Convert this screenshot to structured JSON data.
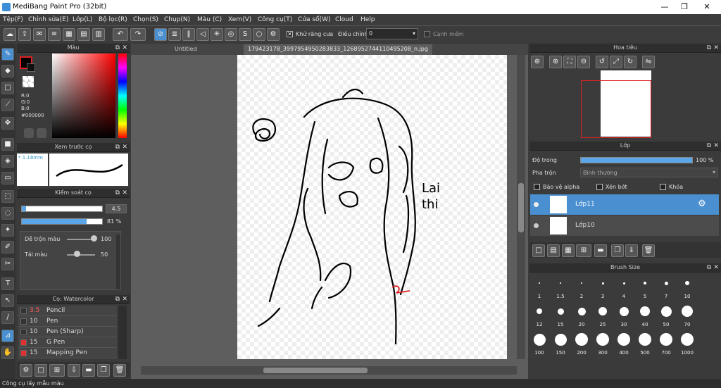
{
  "window": {
    "title": "MediBang Paint Pro (32bit)"
  },
  "menu": [
    "Tệp(F)",
    "Chỉnh sửa(E)",
    "Lớp(L)",
    "Bộ lọc(R)",
    "Chọn(S)",
    "Chụp(N)",
    "Màu (C)",
    "Xem(V)",
    "Công cụ(T)",
    "Cửa sổ(W)",
    "Cloud",
    "Help"
  ],
  "toolbar": {
    "antialias_label": "Khử răng cưa",
    "correction_label": "Điều chỉnh",
    "correction_value": "0",
    "sharp_label": "Cạnh mềm"
  },
  "color_panel": {
    "title": "Màu",
    "r": "R:0",
    "g": "G:0",
    "b": "B:0",
    "hex": "#000000",
    "accent": "#4a90d0"
  },
  "brush_preview": {
    "title": "Xem trước cọ",
    "size": "* 1.18mm"
  },
  "brush_control": {
    "title": "Kiểm soát cọ",
    "size_value": "4.5",
    "opacity_value": "81 %",
    "opacity_fraction": 0.81,
    "size_fraction": 0.05,
    "mix_label": "Dễ trộn màu",
    "mix_value": "100",
    "refill_label": "Tải màu",
    "refill_value": "50"
  },
  "brush_list": {
    "title": "Cọ: Watercolor",
    "items": [
      {
        "size": "3.5",
        "name": "Pencil",
        "color": "#333333",
        "red": true
      },
      {
        "size": "10",
        "name": "Pen",
        "color": "#333333",
        "red": false
      },
      {
        "size": "10",
        "name": "Pen (Sharp)",
        "color": "#333333",
        "red": false
      },
      {
        "size": "15",
        "name": "G Pen",
        "color": "#e03030",
        "red": false
      },
      {
        "size": "15",
        "name": "Mapping Pen",
        "color": "#e03030",
        "red": false
      }
    ]
  },
  "canvas": {
    "tab1": "Untitled",
    "tab2": "179423178_3997954950283833_1268952744110495208_n.jpg",
    "sketch_text1": "Lai",
    "sketch_text2": "thi"
  },
  "navigator": {
    "title": "Hoa tiêu"
  },
  "layers": {
    "title": "Lớp",
    "opacity_label": "Độ trong",
    "opacity_value": "100 %",
    "opacity_fraction": 1.0,
    "blend_label": "Pha trộn",
    "blend_value": "Bình thường",
    "protect_alpha": "Bảo vệ alpha",
    "clipping": "Xén bớt",
    "lock": "Khóa",
    "items": [
      {
        "name": "Lớp11",
        "selected": true
      },
      {
        "name": "Lớp10",
        "selected": false
      }
    ]
  },
  "brush_size": {
    "title": "Brush Size",
    "sizes": [
      "1",
      "1.5",
      "2",
      "3",
      "4",
      "5",
      "7",
      "10",
      "12",
      "15",
      "20",
      "25",
      "30",
      "40",
      "50",
      "70",
      "100",
      "150",
      "200",
      "300",
      "400",
      "500",
      "700",
      "1000"
    ]
  },
  "status": {
    "text": "Công cụ lấy mẫu màu"
  }
}
